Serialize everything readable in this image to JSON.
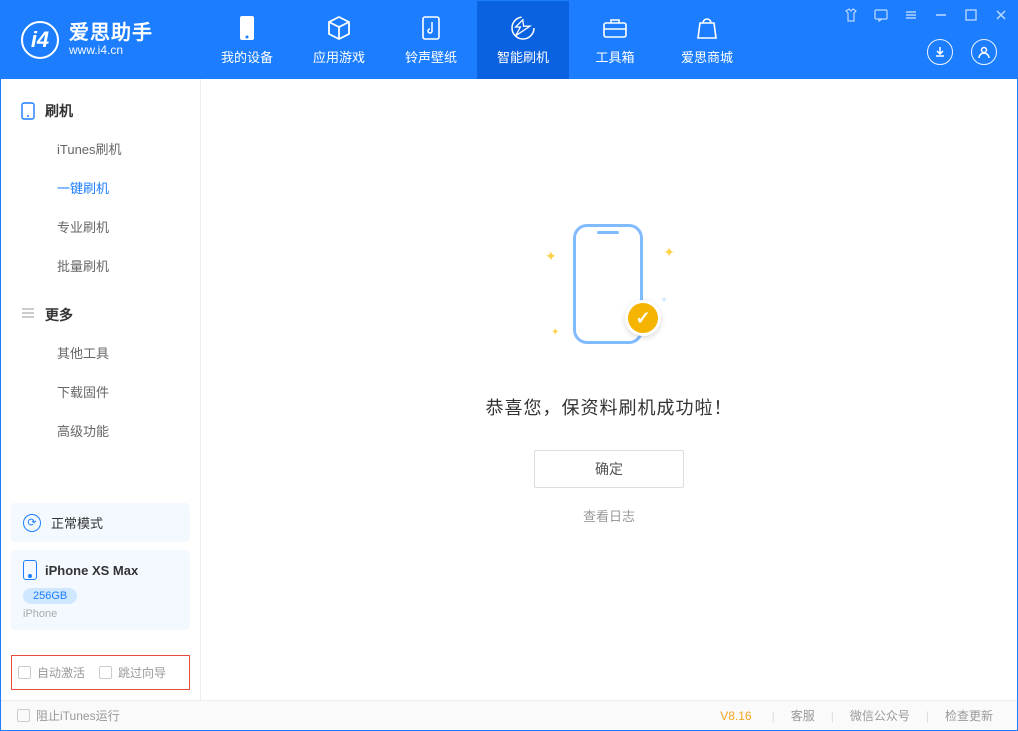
{
  "app": {
    "name": "爱思助手",
    "url": "www.i4.cn"
  },
  "nav": [
    {
      "label": "我的设备",
      "icon": "device"
    },
    {
      "label": "应用游戏",
      "icon": "cube"
    },
    {
      "label": "铃声壁纸",
      "icon": "music"
    },
    {
      "label": "智能刷机",
      "icon": "refresh"
    },
    {
      "label": "工具箱",
      "icon": "toolbox"
    },
    {
      "label": "爱思商城",
      "icon": "store"
    }
  ],
  "sidebar": {
    "group1": {
      "title": "刷机",
      "items": [
        "iTunes刷机",
        "一键刷机",
        "专业刷机",
        "批量刷机"
      ],
      "activeIndex": 1
    },
    "group2": {
      "title": "更多",
      "items": [
        "其他工具",
        "下载固件",
        "高级功能"
      ]
    }
  },
  "deviceMode": {
    "label": "正常模式"
  },
  "device": {
    "name": "iPhone XS Max",
    "storage": "256GB",
    "type": "iPhone"
  },
  "options": {
    "autoActivate": "自动激活",
    "skipGuide": "跳过向导"
  },
  "main": {
    "successText": "恭喜您，保资料刷机成功啦！",
    "confirm": "确定",
    "viewLog": "查看日志"
  },
  "footer": {
    "blockItunes": "阻止iTunes运行",
    "version": "V8.16",
    "links": [
      "客服",
      "微信公众号",
      "检查更新"
    ]
  }
}
